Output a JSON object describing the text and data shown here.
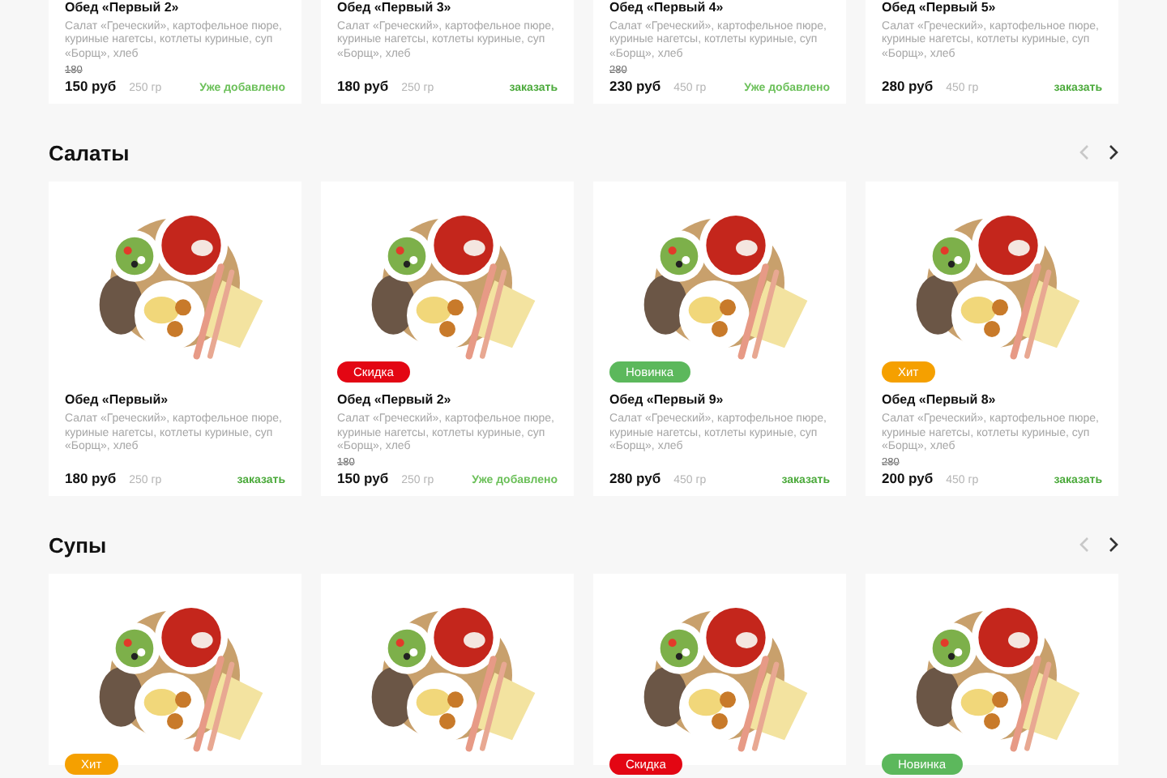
{
  "sections": [
    {
      "items": [
        {
          "kind": "details",
          "name": "Обед «Первый 2»",
          "description": "Салат «Греческий», картофельное пюре, куриные нагетсы, котлеты куриные, суп «Борщ», хлеб",
          "old_price": "180",
          "price": "150 руб",
          "weight": "250 гр",
          "action": {
            "label": "Уже добавлено",
            "kind": "added"
          }
        },
        {
          "kind": "details",
          "name": "Обед «Первый 3»",
          "description": "Салат «Греческий», картофельное пюре, куриные нагетсы, котлеты куриные, суп «Борщ», хлеб",
          "price": "180 руб",
          "weight": "250 гр",
          "action": {
            "label": "заказать",
            "kind": "order"
          }
        },
        {
          "kind": "details",
          "name": "Обед «Первый 4»",
          "description": "Салат «Греческий», картофельное пюре, куриные нагетсы, котлеты куриные, суп «Борщ», хлеб",
          "old_price": "280",
          "price": "230 руб",
          "weight": "450 гр",
          "action": {
            "label": "Уже добавлено",
            "kind": "added"
          }
        },
        {
          "kind": "details",
          "name": "Обед «Первый 5»",
          "description": "Салат «Греческий», картофельное пюре, куриные нагетсы, котлеты куриные, суп «Борщ», хлеб",
          "price": "280 руб",
          "weight": "450 гр",
          "action": {
            "label": "заказать",
            "kind": "order"
          }
        }
      ]
    },
    {
      "title": "Салаты",
      "nav": {
        "prev_disabled": true,
        "next_disabled": false
      },
      "items": [
        {
          "kind": "full",
          "name": "Обед «Первый»",
          "description": "Салат «Греческий», картофельное пюре, куриные нагетсы, котлеты куриные, суп «Борщ», хлеб",
          "price": "180 руб",
          "weight": "250 гр",
          "action": {
            "label": "заказать",
            "kind": "order"
          }
        },
        {
          "kind": "full",
          "badge": {
            "label": "Скидка",
            "color": "#e30613"
          },
          "name": "Обед «Первый 2»",
          "description": "Салат «Греческий», картофельное пюре, куриные нагетсы, котлеты куриные, суп «Борщ», хлеб",
          "old_price": "180",
          "price": "150 руб",
          "weight": "250 гр",
          "action": {
            "label": "Уже добавлено",
            "kind": "added"
          }
        },
        {
          "kind": "full",
          "badge": {
            "label": "Новинка",
            "color": "#5cb85c"
          },
          "name": "Обед «Первый 9»",
          "description": "Салат «Греческий», картофельное пюре, куриные нагетсы, котлеты куриные, суп «Борщ», хлеб",
          "price": "280 руб",
          "weight": "450 гр",
          "action": {
            "label": "заказать",
            "kind": "order"
          }
        },
        {
          "kind": "full",
          "badge": {
            "label": "Хит",
            "color": "#f5a000"
          },
          "name": "Обед «Первый 8»",
          "description": "Салат «Греческий», картофельное пюре, куриные нагетсы, котлеты куриные, суп «Борщ», хлеб",
          "old_price": "280",
          "price": "200 руб",
          "weight": "450 гр",
          "action": {
            "label": "заказать",
            "kind": "order"
          }
        }
      ]
    },
    {
      "title": "Супы",
      "nav": {
        "prev_disabled": true,
        "next_disabled": false
      },
      "items": [
        {
          "kind": "photo",
          "badge": {
            "label": "Хит",
            "color": "#f5a000"
          }
        },
        {
          "kind": "photo"
        },
        {
          "kind": "photo",
          "badge": {
            "label": "Скидка",
            "color": "#e30613"
          }
        },
        {
          "kind": "photo",
          "badge": {
            "label": "Новинка",
            "color": "#5cb85c"
          }
        }
      ]
    }
  ]
}
